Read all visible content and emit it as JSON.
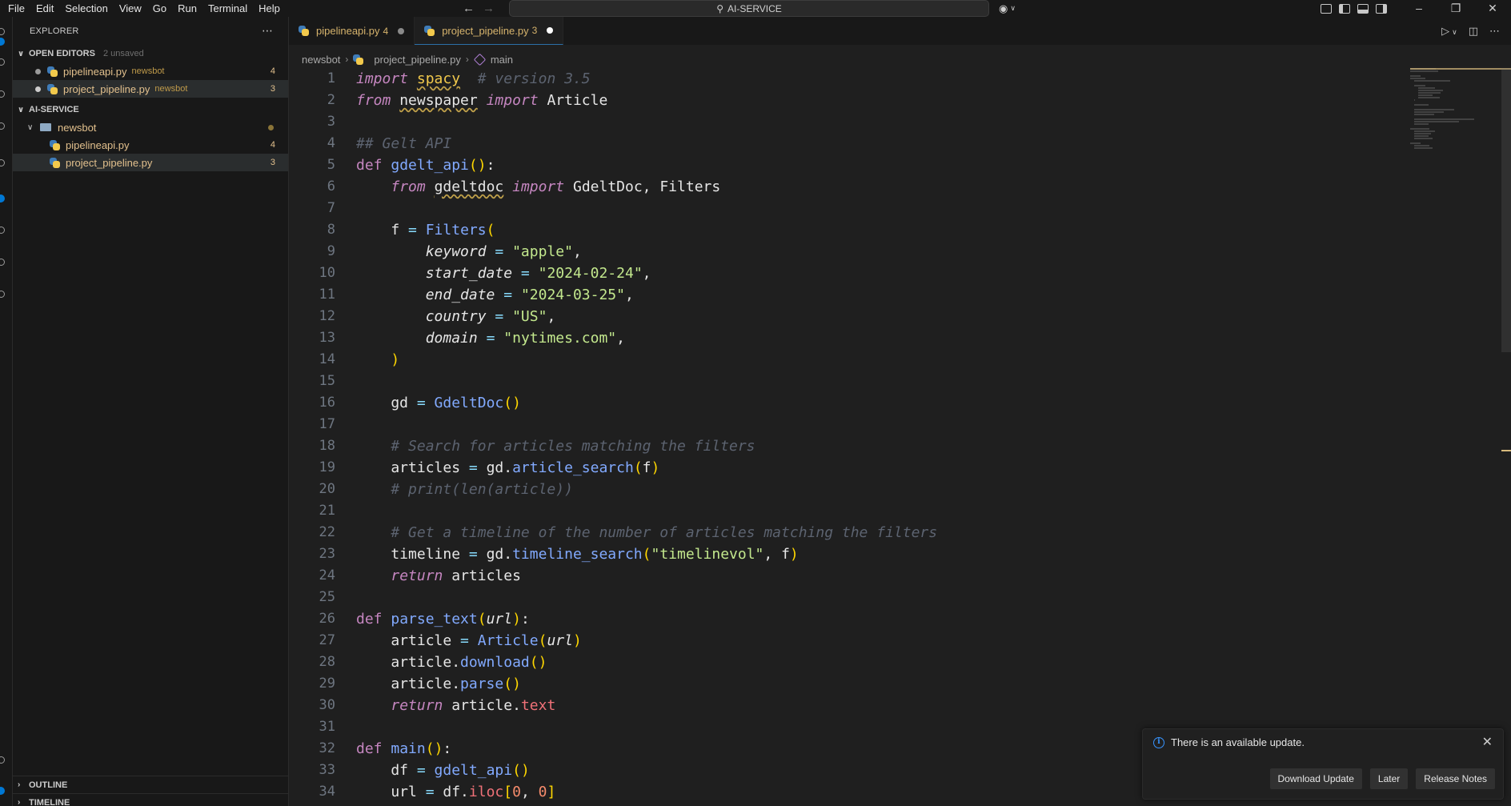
{
  "menu": [
    "File",
    "Edit",
    "Selection",
    "View",
    "Go",
    "Run",
    "Terminal",
    "Help"
  ],
  "command_center": {
    "label": "AI-SERVICE"
  },
  "sidebar": {
    "title": "EXPLORER",
    "open_editors": {
      "label": "OPEN EDITORS",
      "unsaved": "2 unsaved",
      "items": [
        {
          "name": "pipelineapi.py",
          "folder": "newsbot",
          "count": "4"
        },
        {
          "name": "project_pipeline.py",
          "folder": "newsbot",
          "count": "3"
        }
      ]
    },
    "workspace": {
      "label": "AI-SERVICE",
      "folder": "newsbot",
      "files": [
        {
          "name": "pipelineapi.py",
          "count": "4"
        },
        {
          "name": "project_pipeline.py",
          "count": "3"
        }
      ]
    },
    "outline_label": "OUTLINE",
    "timeline_label": "TIMELINE"
  },
  "tabs": [
    {
      "name": "pipelineapi.py",
      "count": "4"
    },
    {
      "name": "project_pipeline.py",
      "count": "3"
    }
  ],
  "breadcrumb": {
    "folder": "newsbot",
    "file": "project_pipeline.py",
    "symbol": "main"
  },
  "code_lines": [
    "import spacy  # version 3.5",
    "from newspaper import Article",
    "",
    "## Gelt API",
    "def gdelt_api():",
    "    from gdeltdoc import GdeltDoc, Filters",
    "",
    "    f = Filters(",
    "        keyword = \"apple\",",
    "        start_date = \"2024-02-24\",",
    "        end_date = \"2024-03-25\",",
    "        country = \"US\",",
    "        domain = \"nytimes.com\",",
    "    )",
    "",
    "    gd = GdeltDoc()",
    "",
    "    # Search for articles matching the filters",
    "    articles = gd.article_search(f)",
    "    # print(len(article))",
    "",
    "    # Get a timeline of the number of articles matching the filters",
    "    timeline = gd.timeline_search(\"timelinevol\", f)",
    "    return articles",
    "",
    "def parse_text(url):",
    "    article = Article(url)",
    "    article.download()",
    "    article.parse()",
    "    return article.text",
    "",
    "def main():",
    "    df = gdelt_api()",
    "    url = df.iloc[0, 0]"
  ],
  "notification": {
    "message": "There is an available update.",
    "buttons": [
      "Download Update",
      "Later",
      "Release Notes"
    ]
  }
}
